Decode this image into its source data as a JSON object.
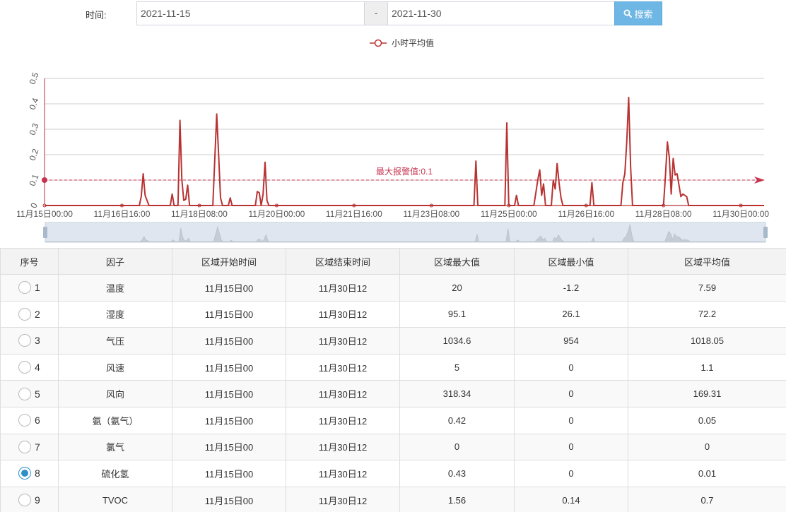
{
  "search": {
    "label": "时间:",
    "start_date": "2021-11-15",
    "separator": "-",
    "end_date": "2021-11-30",
    "button_label": "搜索",
    "button_icon": "search-icon"
  },
  "chart_data": {
    "type": "line",
    "legend": {
      "label": "小时平均值",
      "position": "top-center"
    },
    "series": [
      {
        "name": "小时平均值",
        "color": "#b83232"
      }
    ],
    "ylim": [
      0,
      0.5
    ],
    "y_ticks": [
      "0",
      "0.1",
      "0.2",
      "0.3",
      "0.4",
      "0.5"
    ],
    "x_range_hours": [
      0,
      372
    ],
    "x_ticks": [
      {
        "hour": 0,
        "label": "11月15日00:00"
      },
      {
        "hour": 40,
        "label": "11月16日16:00"
      },
      {
        "hour": 80,
        "label": "11月18日08:00"
      },
      {
        "hour": 120,
        "label": "11月20日00:00"
      },
      {
        "hour": 160,
        "label": "11月21日16:00"
      },
      {
        "hour": 200,
        "label": "11月23日08:00"
      },
      {
        "hour": 240,
        "label": "11月25日00:00"
      },
      {
        "hour": 280,
        "label": "11月26日16:00"
      },
      {
        "hour": 320,
        "label": "11月28日08:00"
      },
      {
        "hour": 360,
        "label": "11月30日00:00"
      }
    ],
    "mark_line": {
      "value": 0.1,
      "label": "最大报警值:0.1",
      "color": "#c8324f"
    },
    "points": [
      [
        0,
        0
      ],
      [
        49,
        0
      ],
      [
        50,
        0.035
      ],
      [
        51,
        0.125
      ],
      [
        52,
        0.04
      ],
      [
        53,
        0.02
      ],
      [
        54,
        0
      ],
      [
        65,
        0
      ],
      [
        66,
        0.045
      ],
      [
        67,
        0
      ],
      [
        69,
        0
      ],
      [
        70,
        0.335
      ],
      [
        71,
        0.1
      ],
      [
        72,
        0.02
      ],
      [
        73,
        0.025
      ],
      [
        74,
        0.08
      ],
      [
        75,
        0
      ],
      [
        87,
        0
      ],
      [
        89,
        0.36
      ],
      [
        90,
        0.2
      ],
      [
        91,
        0.03
      ],
      [
        92,
        0
      ],
      [
        95,
        0
      ],
      [
        96,
        0.03
      ],
      [
        97,
        0
      ],
      [
        109,
        0
      ],
      [
        110,
        0.055
      ],
      [
        111,
        0.05
      ],
      [
        112,
        0
      ],
      [
        113,
        0.045
      ],
      [
        114,
        0.17
      ],
      [
        115,
        0.02
      ],
      [
        116,
        0
      ],
      [
        222,
        0
      ],
      [
        223,
        0.175
      ],
      [
        224,
        0
      ],
      [
        238,
        0
      ],
      [
        239,
        0.325
      ],
      [
        240,
        0
      ],
      [
        243,
        0
      ],
      [
        244,
        0.04
      ],
      [
        245,
        0
      ],
      [
        253,
        0
      ],
      [
        254,
        0.05
      ],
      [
        255,
        0.1
      ],
      [
        256,
        0.14
      ],
      [
        257,
        0.04
      ],
      [
        258,
        0.085
      ],
      [
        259,
        0
      ],
      [
        262,
        0
      ],
      [
        263,
        0.1
      ],
      [
        264,
        0.065
      ],
      [
        265,
        0.165
      ],
      [
        266,
        0.09
      ],
      [
        267,
        0.03
      ],
      [
        268,
        0
      ],
      [
        282,
        0
      ],
      [
        283,
        0.09
      ],
      [
        284,
        0
      ],
      [
        298,
        0
      ],
      [
        299,
        0.09
      ],
      [
        300,
        0.125
      ],
      [
        301,
        0.25
      ],
      [
        302,
        0.425
      ],
      [
        303,
        0.15
      ],
      [
        304,
        0
      ],
      [
        320,
        0
      ],
      [
        321,
        0.115
      ],
      [
        322,
        0.25
      ],
      [
        323,
        0.19
      ],
      [
        324,
        0.045
      ],
      [
        325,
        0.185
      ],
      [
        326,
        0.12
      ],
      [
        327,
        0.125
      ],
      [
        328,
        0.08
      ],
      [
        329,
        0.035
      ],
      [
        330,
        0.045
      ],
      [
        331,
        0.04
      ],
      [
        332,
        0.035
      ],
      [
        333,
        0
      ],
      [
        372,
        0
      ]
    ]
  },
  "table": {
    "columns": [
      "序号",
      "因子",
      "区域开始时间",
      "区域结束时间",
      "区域最大值",
      "区域最小值",
      "区域平均值"
    ],
    "selected_index": 7,
    "rows": [
      {
        "no": "1",
        "factor": "温度",
        "start": "11月15日00",
        "end": "11月30日12",
        "max": "20",
        "min": "-1.2",
        "avg": "7.59"
      },
      {
        "no": "2",
        "factor": "湿度",
        "start": "11月15日00",
        "end": "11月30日12",
        "max": "95.1",
        "min": "26.1",
        "avg": "72.2"
      },
      {
        "no": "3",
        "factor": "气压",
        "start": "11月15日00",
        "end": "11月30日12",
        "max": "1034.6",
        "min": "954",
        "avg": "1018.05"
      },
      {
        "no": "4",
        "factor": "风速",
        "start": "11月15日00",
        "end": "11月30日12",
        "max": "5",
        "min": "0",
        "avg": "1.1"
      },
      {
        "no": "5",
        "factor": "风向",
        "start": "11月15日00",
        "end": "11月30日12",
        "max": "318.34",
        "min": "0",
        "avg": "169.31"
      },
      {
        "no": "6",
        "factor": "氨（氨气）",
        "start": "11月15日00",
        "end": "11月30日12",
        "max": "0.42",
        "min": "0",
        "avg": "0.05"
      },
      {
        "no": "7",
        "factor": "氯气",
        "start": "11月15日00",
        "end": "11月30日12",
        "max": "0",
        "min": "0",
        "avg": "0"
      },
      {
        "no": "8",
        "factor": "硫化氢",
        "start": "11月15日00",
        "end": "11月30日12",
        "max": "0.43",
        "min": "0",
        "avg": "0.01"
      },
      {
        "no": "9",
        "factor": "TVOC",
        "start": "11月15日00",
        "end": "11月30日12",
        "max": "1.56",
        "min": "0.14",
        "avg": "0.7"
      }
    ]
  }
}
